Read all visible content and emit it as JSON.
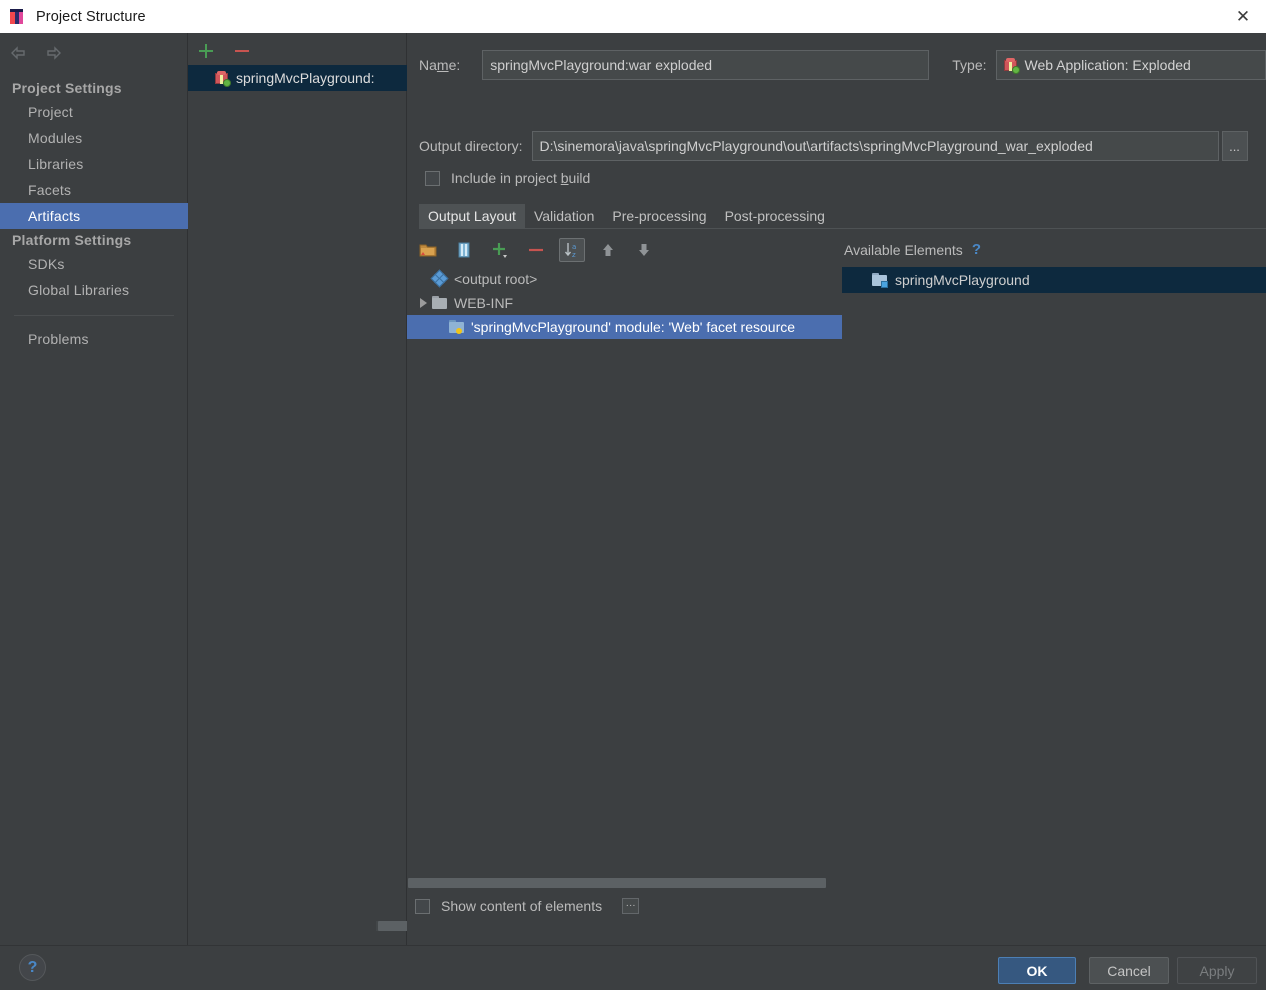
{
  "window": {
    "title": "Project Structure",
    "app_icon": "intellij-idea-icon",
    "close_label": "✕"
  },
  "sidebar": {
    "nav": {
      "back_icon": "back-arrow-icon",
      "forward_icon": "forward-arrow-icon"
    },
    "groups": [
      {
        "label": "Project Settings",
        "items": [
          {
            "label": "Project",
            "selected": false
          },
          {
            "label": "Modules",
            "selected": false
          },
          {
            "label": "Libraries",
            "selected": false
          },
          {
            "label": "Facets",
            "selected": false
          },
          {
            "label": "Artifacts",
            "selected": true
          }
        ]
      },
      {
        "label": "Platform Settings",
        "items": [
          {
            "label": "SDKs",
            "selected": false
          },
          {
            "label": "Global Libraries",
            "selected": false
          }
        ]
      }
    ],
    "problems": {
      "label": "Problems"
    }
  },
  "artifacts_panel": {
    "toolbar": {
      "add_label": "+",
      "remove_label": "−"
    },
    "items": [
      {
        "label": "springMvcPlayground:",
        "selected": true,
        "icon": "artifact-icon"
      }
    ]
  },
  "editor": {
    "name": {
      "label": "Name:",
      "mnemonic": "m",
      "value": "springMvcPlayground:war exploded"
    },
    "type": {
      "label": "Type:",
      "value": "Web Application: Exploded",
      "icon": "artifact-icon",
      "arrow_icon": "chevron-down-icon"
    },
    "output_directory": {
      "label": "Output directory:",
      "value": "D:\\sinemora\\java\\springMvcPlayground\\out\\artifacts\\springMvcPlayground_war_exploded",
      "browse_label": "..."
    },
    "include_in_build": {
      "label_before": "Include in project ",
      "mnemonic": "b",
      "label_after": "uild",
      "checked": false
    },
    "tabs": [
      {
        "label": "Output Layout",
        "active": true
      },
      {
        "label": "Validation",
        "active": false
      },
      {
        "label": "Pre-processing",
        "active": false
      },
      {
        "label": "Post-processing",
        "active": false
      }
    ],
    "layout_toolbar": [
      {
        "name": "create-directory-icon",
        "pressed": false
      },
      {
        "name": "create-archive-icon",
        "pressed": false
      },
      {
        "name": "add-copy-icon",
        "pressed": false
      },
      {
        "name": "remove-icon",
        "pressed": false
      },
      {
        "name": "sort-alphabetically-icon",
        "pressed": true
      },
      {
        "name": "move-up-icon",
        "pressed": false
      },
      {
        "name": "move-down-icon",
        "pressed": false
      }
    ],
    "output_tree": [
      {
        "label": "<output root>",
        "icon": "output-root-icon",
        "indent": 0,
        "expandable": false,
        "selected": false
      },
      {
        "label": "WEB-INF",
        "icon": "folder-icon",
        "indent": 0,
        "expandable": true,
        "selected": false
      },
      {
        "label": "'springMvcPlayground' module: 'Web' facet resource",
        "icon": "facet-resource-icon",
        "indent": 1,
        "expandable": false,
        "selected": true
      }
    ],
    "available_elements": {
      "title": "Available Elements",
      "help_label": "?",
      "items": [
        {
          "label": "springMvcPlayground",
          "icon": "module-folder-icon",
          "selected": true
        }
      ]
    },
    "show_content": {
      "label": "Show content of elements",
      "checked": false,
      "dots_label": "···"
    }
  },
  "footer": {
    "help_label": "?",
    "ok_label": "OK",
    "cancel_label": "Cancel",
    "apply_label": "Apply"
  }
}
